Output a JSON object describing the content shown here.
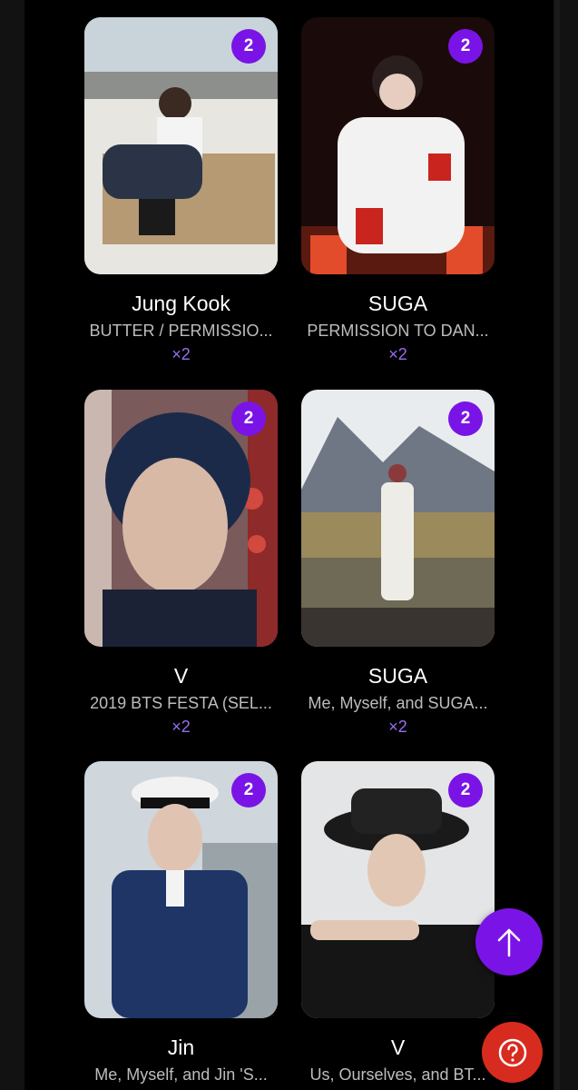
{
  "cards": [
    {
      "name": "Jung Kook",
      "title": "BUTTER / PERMISSIO...",
      "count": "2",
      "qty": "×2",
      "image": "member photo in pickup truck"
    },
    {
      "name": "SUGA",
      "title": "PERMISSION TO DAN...",
      "count": "2",
      "qty": "×2",
      "image": "member on stage in white outfit"
    },
    {
      "name": "V",
      "title": "2019 BTS FESTA (SEL...",
      "count": "2",
      "qty": "×2",
      "image": "member selfie close-up"
    },
    {
      "name": "SUGA",
      "title": "Me, Myself, and SUGA...",
      "count": "2",
      "qty": "×2",
      "image": "member in white coat in mountain landscape"
    },
    {
      "name": "Jin",
      "title": "Me, Myself, and Jin 'S...",
      "count": "2",
      "qty": "×2",
      "image": "member in navy captain uniform"
    },
    {
      "name": "V",
      "title": "Us, Ourselves, and BT...",
      "count": "2",
      "qty": "×2",
      "image": "member in black hat"
    }
  ],
  "colors": {
    "accent": "#7a14e6",
    "help": "#d82b1f",
    "background": "#000000"
  },
  "icons": {
    "scroll_top": "arrow-up-icon",
    "help": "question-circle-icon"
  }
}
